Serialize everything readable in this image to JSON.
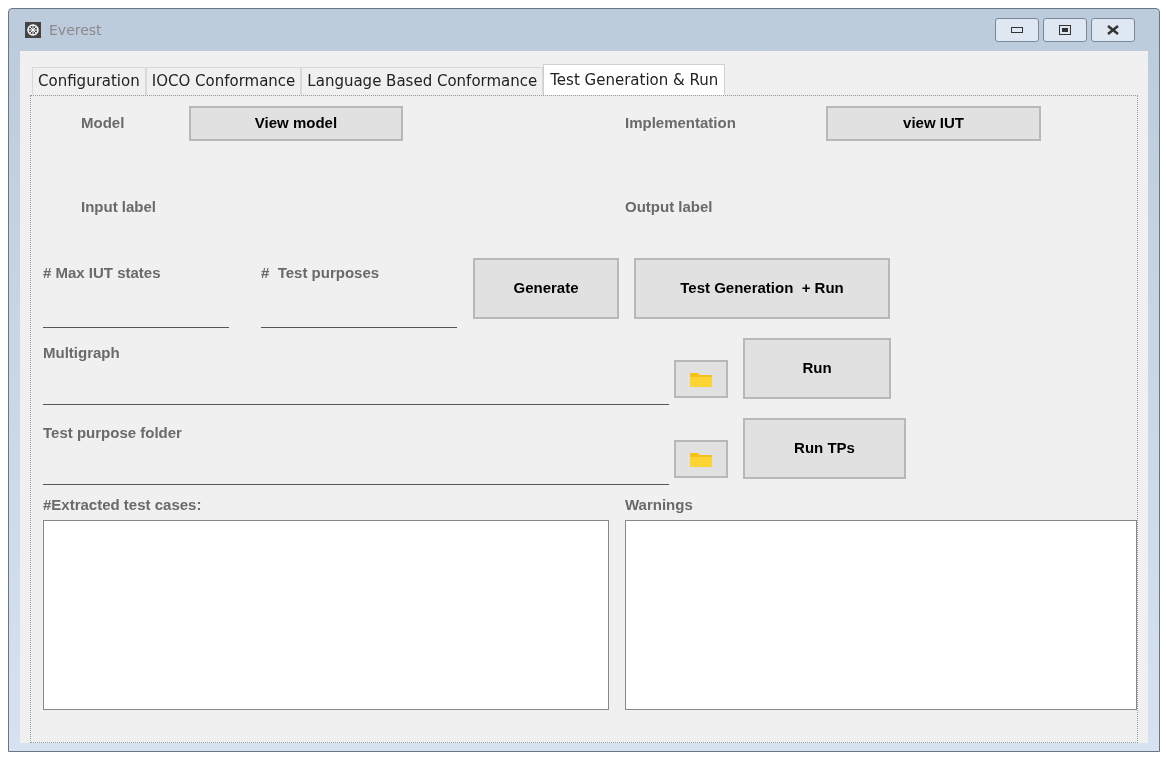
{
  "window": {
    "title": "Everest"
  },
  "tabs": [
    {
      "label": "Configuration",
      "selected": false
    },
    {
      "label": "IOCO Conformance",
      "selected": false
    },
    {
      "label": "Language Based Conformance",
      "selected": false
    },
    {
      "label": "Test Generation & Run",
      "selected": true
    }
  ],
  "model": {
    "label": "Model",
    "button": "View model"
  },
  "implementation": {
    "label": "Implementation",
    "button": "view IUT"
  },
  "input_label": "Input label",
  "output_label": "Output label",
  "max_iut_states": {
    "label": "# Max IUT states"
  },
  "test_purposes": {
    "label": "#  Test purposes"
  },
  "generate_button": "Generate",
  "test_generation_run_button": "Test Generation  + Run",
  "multigraph": {
    "label": "Multigraph"
  },
  "run_button": "Run",
  "test_purpose_folder": {
    "label": "Test purpose folder"
  },
  "run_tps_button": "Run TPs",
  "extracted_test_cases": {
    "label": "#Extracted test cases:"
  },
  "warnings": {
    "label": "Warnings"
  }
}
